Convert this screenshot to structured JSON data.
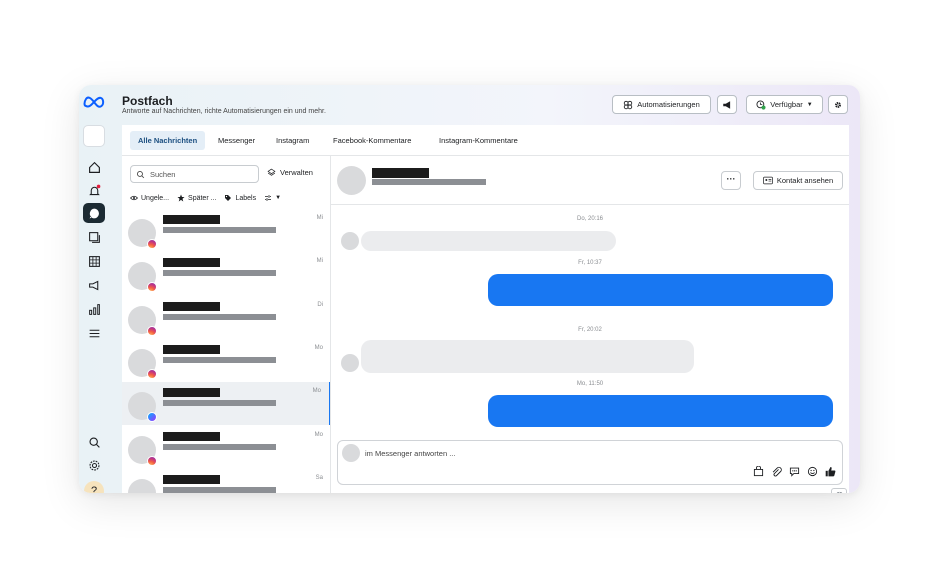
{
  "header": {
    "title": "Postfach",
    "subtitle": "Antworte auf Nachrichten, richte Automatisierungen ein und mehr.",
    "automations_label": "Automatisierungen",
    "availability_label": "Verfügbar"
  },
  "tabs": [
    {
      "label": "Alle Nachrichten",
      "active": true
    },
    {
      "label": "Messenger"
    },
    {
      "label": "Instagram"
    },
    {
      "label": "Facebook-Kommentare"
    },
    {
      "label": "Instagram-Kommentare"
    }
  ],
  "list": {
    "search_placeholder": "Suchen",
    "manage_label": "Verwalten",
    "filters": [
      "Ungele...",
      "Später ...",
      "Labels"
    ],
    "conversations": [
      {
        "date": "Mi",
        "platform": "instagram"
      },
      {
        "date": "Mi",
        "platform": "instagram"
      },
      {
        "date": "Di",
        "platform": "instagram"
      },
      {
        "date": "Mo",
        "platform": "instagram"
      },
      {
        "date": "Mo",
        "platform": "messenger",
        "selected": true
      },
      {
        "date": "Mo",
        "platform": "instagram"
      },
      {
        "date": "Sa",
        "platform": "instagram"
      }
    ]
  },
  "chat": {
    "more_label": "···",
    "contact_label": "Kontakt ansehen",
    "timestamps": [
      "Do, 20:16",
      "Fr, 10:37",
      "Fr, 20:02",
      "Mo, 11:50"
    ],
    "composer_placeholder": "im Messenger antworten ..."
  },
  "help_label": "?",
  "colors": {
    "accent": "#1877f2",
    "rail_active": "#1c2b33",
    "tab_active_bg": "#e4eef7"
  }
}
